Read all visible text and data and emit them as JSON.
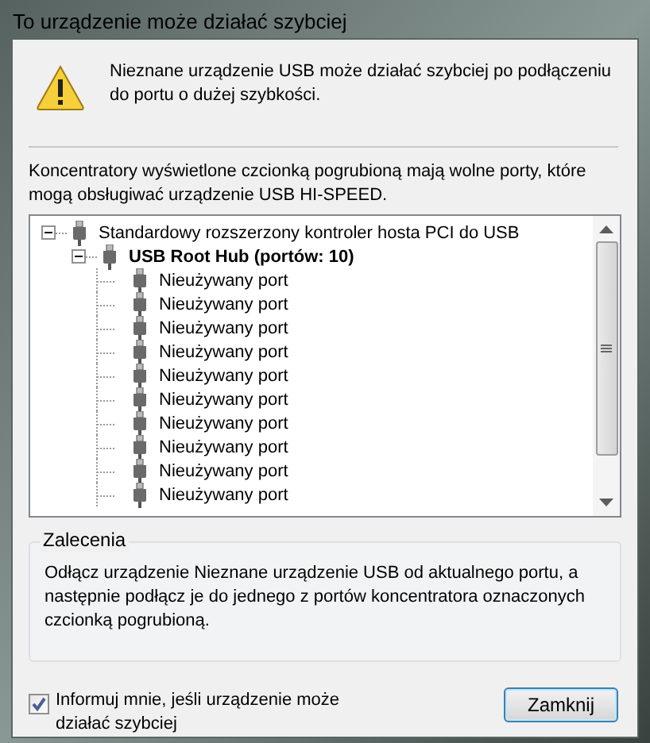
{
  "window": {
    "title": "To urządzenie może działać szybciej"
  },
  "message": "Nieznane urządzenie USB może działać szybciej po podłączeniu do portu o dużej szybkości.",
  "tree_label": "Koncentratory wyświetlone czcionką pogrubioną mają wolne porty, które mogą obsługiwać urządzenie USB HI-SPEED.",
  "tree": [
    {
      "label": "Standardowy rozszerzony kontroler hosta PCI do USB",
      "bold": false,
      "expanded": true,
      "children": [
        {
          "label": "USB Root Hub (portów: 10)",
          "bold": true,
          "expanded": true,
          "children": [
            {
              "label": "Nieużywany port",
              "bold": false
            },
            {
              "label": "Nieużywany port",
              "bold": false
            },
            {
              "label": "Nieużywany port",
              "bold": false
            },
            {
              "label": "Nieużywany port",
              "bold": false
            },
            {
              "label": "Nieużywany port",
              "bold": false
            },
            {
              "label": "Nieużywany port",
              "bold": false
            },
            {
              "label": "Nieużywany port",
              "bold": false
            },
            {
              "label": "Nieużywany port",
              "bold": false
            },
            {
              "label": "Nieużywany port",
              "bold": false
            },
            {
              "label": "Nieużywany port",
              "bold": false
            }
          ]
        }
      ]
    }
  ],
  "recommendations": {
    "title": "Zalecenia",
    "text": "Odłącz urządzenie Nieznane urządzenie USB od aktualnego portu, a następnie podłącz je do jednego z portów koncentratora oznaczonych czcionką pogrubioną."
  },
  "notify_checkbox": {
    "label": "Informuj mnie, jeśli urządzenie może działać szybciej",
    "checked": true
  },
  "buttons": [
    "Zamknij"
  ]
}
